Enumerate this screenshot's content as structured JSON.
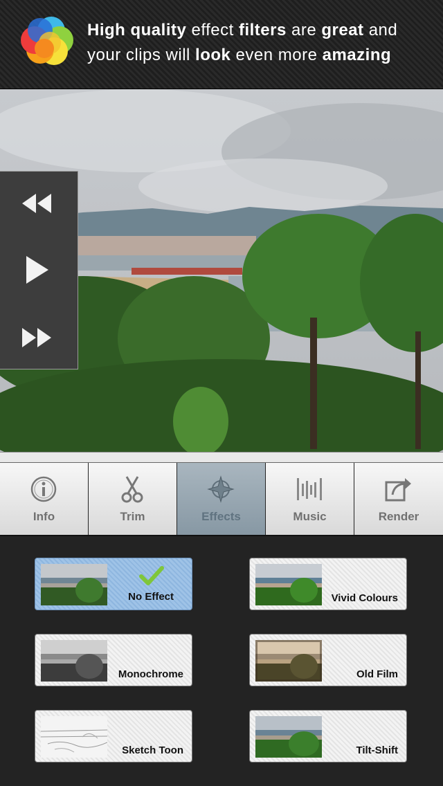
{
  "banner": {
    "w1": "High quality",
    "w2": " effect ",
    "w3": "filters",
    "w4": " are ",
    "w5": "great",
    "w6": " and",
    "w7": "your clips will ",
    "w8": "look",
    "w9": " even more ",
    "w10": "amazing"
  },
  "playback": {
    "rewind_icon": "rewind-icon",
    "play_icon": "play-icon",
    "forward_icon": "fast-forward-icon"
  },
  "tabs": [
    {
      "label": "Info",
      "icon": "info-icon"
    },
    {
      "label": "Trim",
      "icon": "scissors-icon"
    },
    {
      "label": "Effects",
      "icon": "effects-icon",
      "active": true
    },
    {
      "label": "Music",
      "icon": "equalizer-icon"
    },
    {
      "label": "Render",
      "icon": "share-icon"
    }
  ],
  "effects": [
    {
      "label": "No Effect",
      "selected": true
    },
    {
      "label": "Vivid Colours"
    },
    {
      "label": "Monochrome"
    },
    {
      "label": "Old Film"
    },
    {
      "label": "Sketch Toon"
    },
    {
      "label": "Tilt-Shift"
    }
  ],
  "colors": {
    "selected": "#9fc3e7",
    "active_tab": "#8798a4",
    "check": "#7fc63a"
  }
}
